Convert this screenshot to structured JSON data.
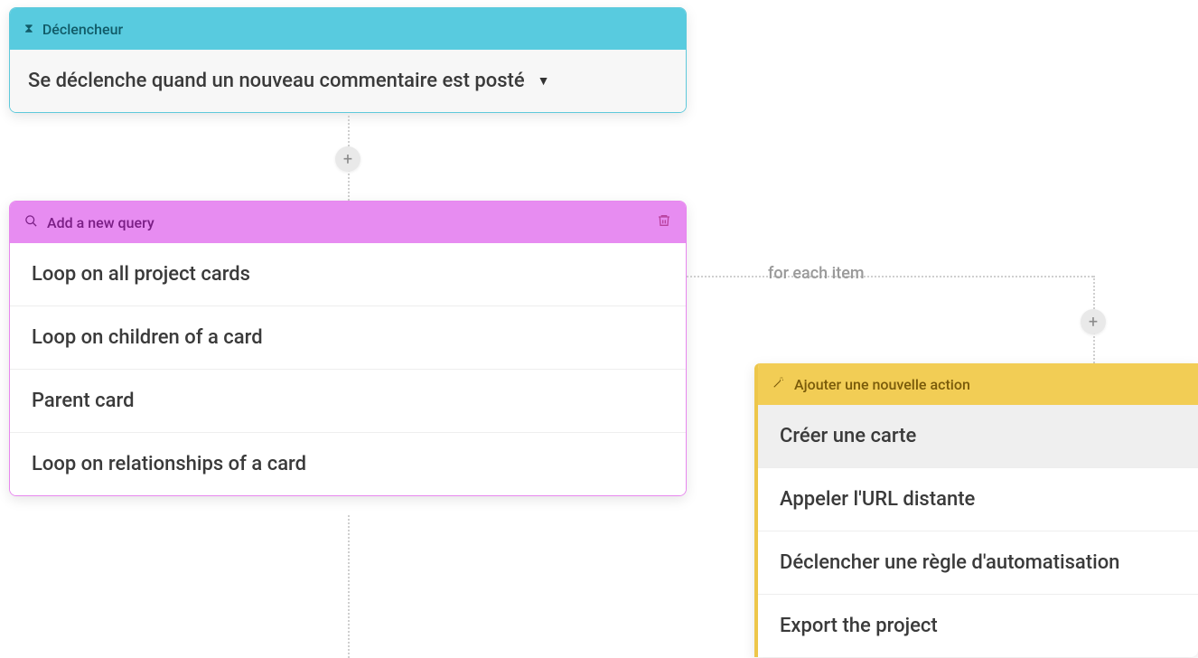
{
  "trigger": {
    "header_label": "Déclencheur",
    "body_text": "Se déclenche quand un nouveau commentaire est posté"
  },
  "query": {
    "header_label": "Add a new query",
    "items": [
      "Loop on all project cards",
      "Loop on children of a card",
      "Parent card",
      "Loop on relationships of a card"
    ]
  },
  "action": {
    "header_label": "Ajouter une nouvelle action",
    "items": [
      "Créer une carte",
      "Appeler l'URL distante",
      "Déclencher une règle d'automatisation",
      "Export the project"
    ],
    "selected_index": 0
  },
  "connector": {
    "for_each_label": "for each item"
  }
}
